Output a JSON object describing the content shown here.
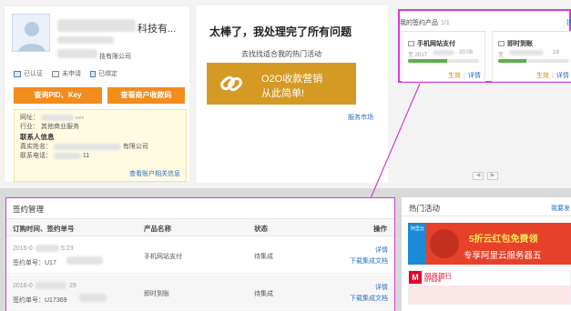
{
  "merchant": {
    "name": "科技有...",
    "company_suffix": "技有限公司",
    "badges": [
      "已认证",
      "未申请",
      "已绑定"
    ],
    "btn_pid": "查询PID、Key",
    "btn_qr": "查看商户收款码",
    "info": {
      "website_label": "网址：",
      "website_value": "com",
      "industry_label": "行业：",
      "industry_value": "其他商业服务",
      "contact_heading": "联系人信息",
      "realname_label": "真实姓名：",
      "realname_value": "有限公司",
      "phone_label": "联系电话：",
      "phone_value": "11",
      "more_link": "查看账户相关信息"
    }
  },
  "status": {
    "title": "太棒了，我处理完了所有问题",
    "subtitle": "去找找适合我的热门活动",
    "promo_line1": "O2O收款营销",
    "promo_line2": "从此简单!",
    "market_link": "服务市场"
  },
  "products": {
    "header": "我的签约产品",
    "count": "1/1",
    "more": "扶",
    "items": [
      {
        "name": "手机网站支付",
        "date_start": "至 2017",
        "date_end": "20:08",
        "progress": 0.55,
        "link_a": "生效",
        "link_b": "详情"
      },
      {
        "name": "即时到账",
        "date_start": "至",
        "date_end": "19",
        "progress": 0.4,
        "link_a": "生效",
        "link_b": "详情"
      }
    ],
    "pager_prev": "◀",
    "pager_next": "▶"
  },
  "orders": {
    "title": "签约管理",
    "columns": [
      "订购时间、签约单号",
      "产品名称",
      "状态",
      "操作"
    ],
    "rows": [
      {
        "time": "2016-0",
        "time_end": "5:23",
        "sign_no": "签约单号：U17",
        "product": "手机网站支付",
        "status": "待集成",
        "action1": "详情",
        "action2": "下载集成文档"
      },
      {
        "time": "2016-0",
        "time_end": "29",
        "sign_no": "签约单号：U17369",
        "product": "即时到账",
        "status": "待集成",
        "action1": "详情",
        "action2": "下载集成文档"
      }
    ]
  },
  "hot": {
    "title": "热门活动",
    "more": "我要发",
    "logo_text": "阿里云",
    "line1": "5折云红包免费领",
    "line2": "专享阿里云服务器五",
    "bank_name": "网商银行",
    "bank_sub": "MYbank"
  },
  "colors": {
    "accent_orange": "#f28c1c",
    "highlight_magenta": "#d43cd4",
    "link_blue": "#2870c2",
    "promo_gold": "#d49a24",
    "hot_red": "#e8412a"
  }
}
